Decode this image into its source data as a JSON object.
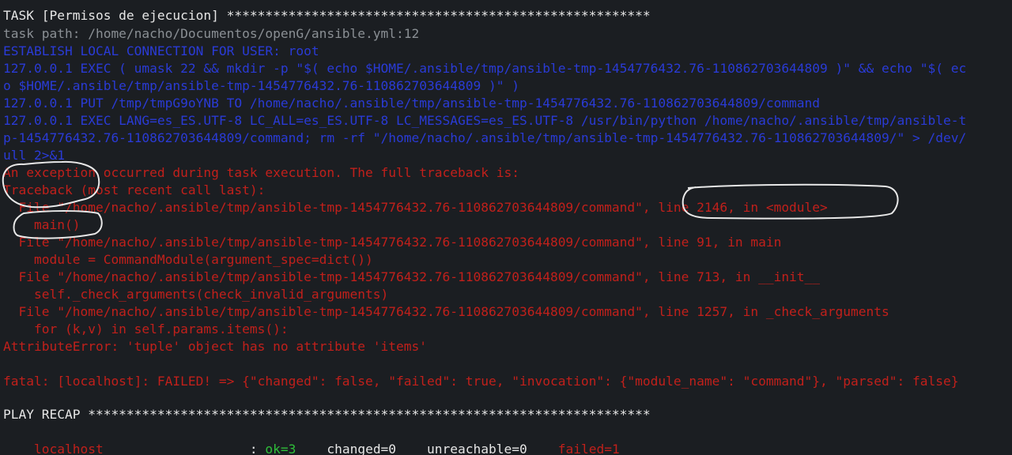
{
  "terminal": {
    "lines": [
      {
        "text": "TASK [Permisos de ejecucion] *******************************************************",
        "color": "#e6e6e6"
      },
      {
        "text": "task path: /home/nacho/Documentos/openG/ansible.yml:12",
        "color": "#8a8f94"
      },
      {
        "text": "ESTABLISH LOCAL CONNECTION FOR USER: root",
        "color": "#2a3bd6"
      },
      {
        "text": "127.0.0.1 EXEC ( umask 22 && mkdir -p \"$( echo $HOME/.ansible/tmp/ansible-tmp-1454776432.76-110862703644809 )\" && echo \"$( ec",
        "color": "#2a3bd6"
      },
      {
        "text": "o $HOME/.ansible/tmp/ansible-tmp-1454776432.76-110862703644809 )\" )",
        "color": "#2a3bd6"
      },
      {
        "text": "127.0.0.1 PUT /tmp/tmpG9oYNB TO /home/nacho/.ansible/tmp/ansible-tmp-1454776432.76-110862703644809/command",
        "color": "#2a3bd6"
      },
      {
        "text": "127.0.0.1 EXEC LANG=es_ES.UTF-8 LC_ALL=es_ES.UTF-8 LC_MESSAGES=es_ES.UTF-8 /usr/bin/python /home/nacho/.ansible/tmp/ansible-t",
        "color": "#2a3bd6"
      },
      {
        "text": "p-1454776432.76-110862703644809/command; rm -rf \"/home/nacho/.ansible/tmp/ansible-tmp-1454776432.76-110862703644809/\" > /dev/",
        "color": "#2a3bd6"
      },
      {
        "text": "ull 2>&1",
        "color": "#2a3bd6"
      },
      {
        "text": "An exception occurred during task execution. The full traceback is:",
        "color": "#c1201b"
      },
      {
        "text": "Traceback (most recent call last):",
        "color": "#c1201b"
      },
      {
        "text": "  File \"/home/nacho/.ansible/tmp/ansible-tmp-1454776432.76-110862703644809/command\", line 2146, in <module>",
        "color": "#c1201b"
      },
      {
        "text": "    main()",
        "color": "#c1201b"
      },
      {
        "text": "  File \"/home/nacho/.ansible/tmp/ansible-tmp-1454776432.76-110862703644809/command\", line 91, in main",
        "color": "#c1201b"
      },
      {
        "text": "    module = CommandModule(argument_spec=dict())",
        "color": "#c1201b"
      },
      {
        "text": "  File \"/home/nacho/.ansible/tmp/ansible-tmp-1454776432.76-110862703644809/command\", line 713, in __init__",
        "color": "#c1201b"
      },
      {
        "text": "    self._check_arguments(check_invalid_arguments)",
        "color": "#c1201b"
      },
      {
        "text": "  File \"/home/nacho/.ansible/tmp/ansible-tmp-1454776432.76-110862703644809/command\", line 1257, in _check_arguments",
        "color": "#c1201b"
      },
      {
        "text": "    for (k,v) in self.params.items():",
        "color": "#c1201b"
      },
      {
        "text": "AttributeError: 'tuple' object has no attribute 'items'",
        "color": "#c1201b"
      },
      {
        "text": "",
        "color": "#c1201b"
      },
      {
        "text": "fatal: [localhost]: FAILED! => {\"changed\": false, \"failed\": true, \"invocation\": {\"module_name\": \"command\"}, \"parsed\": false}",
        "color": "#c1201b"
      },
      {
        "text": "",
        "color": "#e6e6e6"
      },
      {
        "text": "PLAY RECAP *************************************************************************",
        "color": "#e6e6e6"
      }
    ],
    "recap": {
      "host": "localhost",
      "colon": "                   : ",
      "ok": "ok=3",
      "changed": "    changed=0",
      "unreachable": "    unreachable=0",
      "failed": "    failed=1"
    },
    "colors": {
      "background": "#1b1e22",
      "white": "#e6e6e6",
      "grey": "#8a8f94",
      "blue": "#2a3bd6",
      "red": "#c1201b",
      "green": "#2fbf3a",
      "annotation": "#e8e8e8"
    }
  }
}
